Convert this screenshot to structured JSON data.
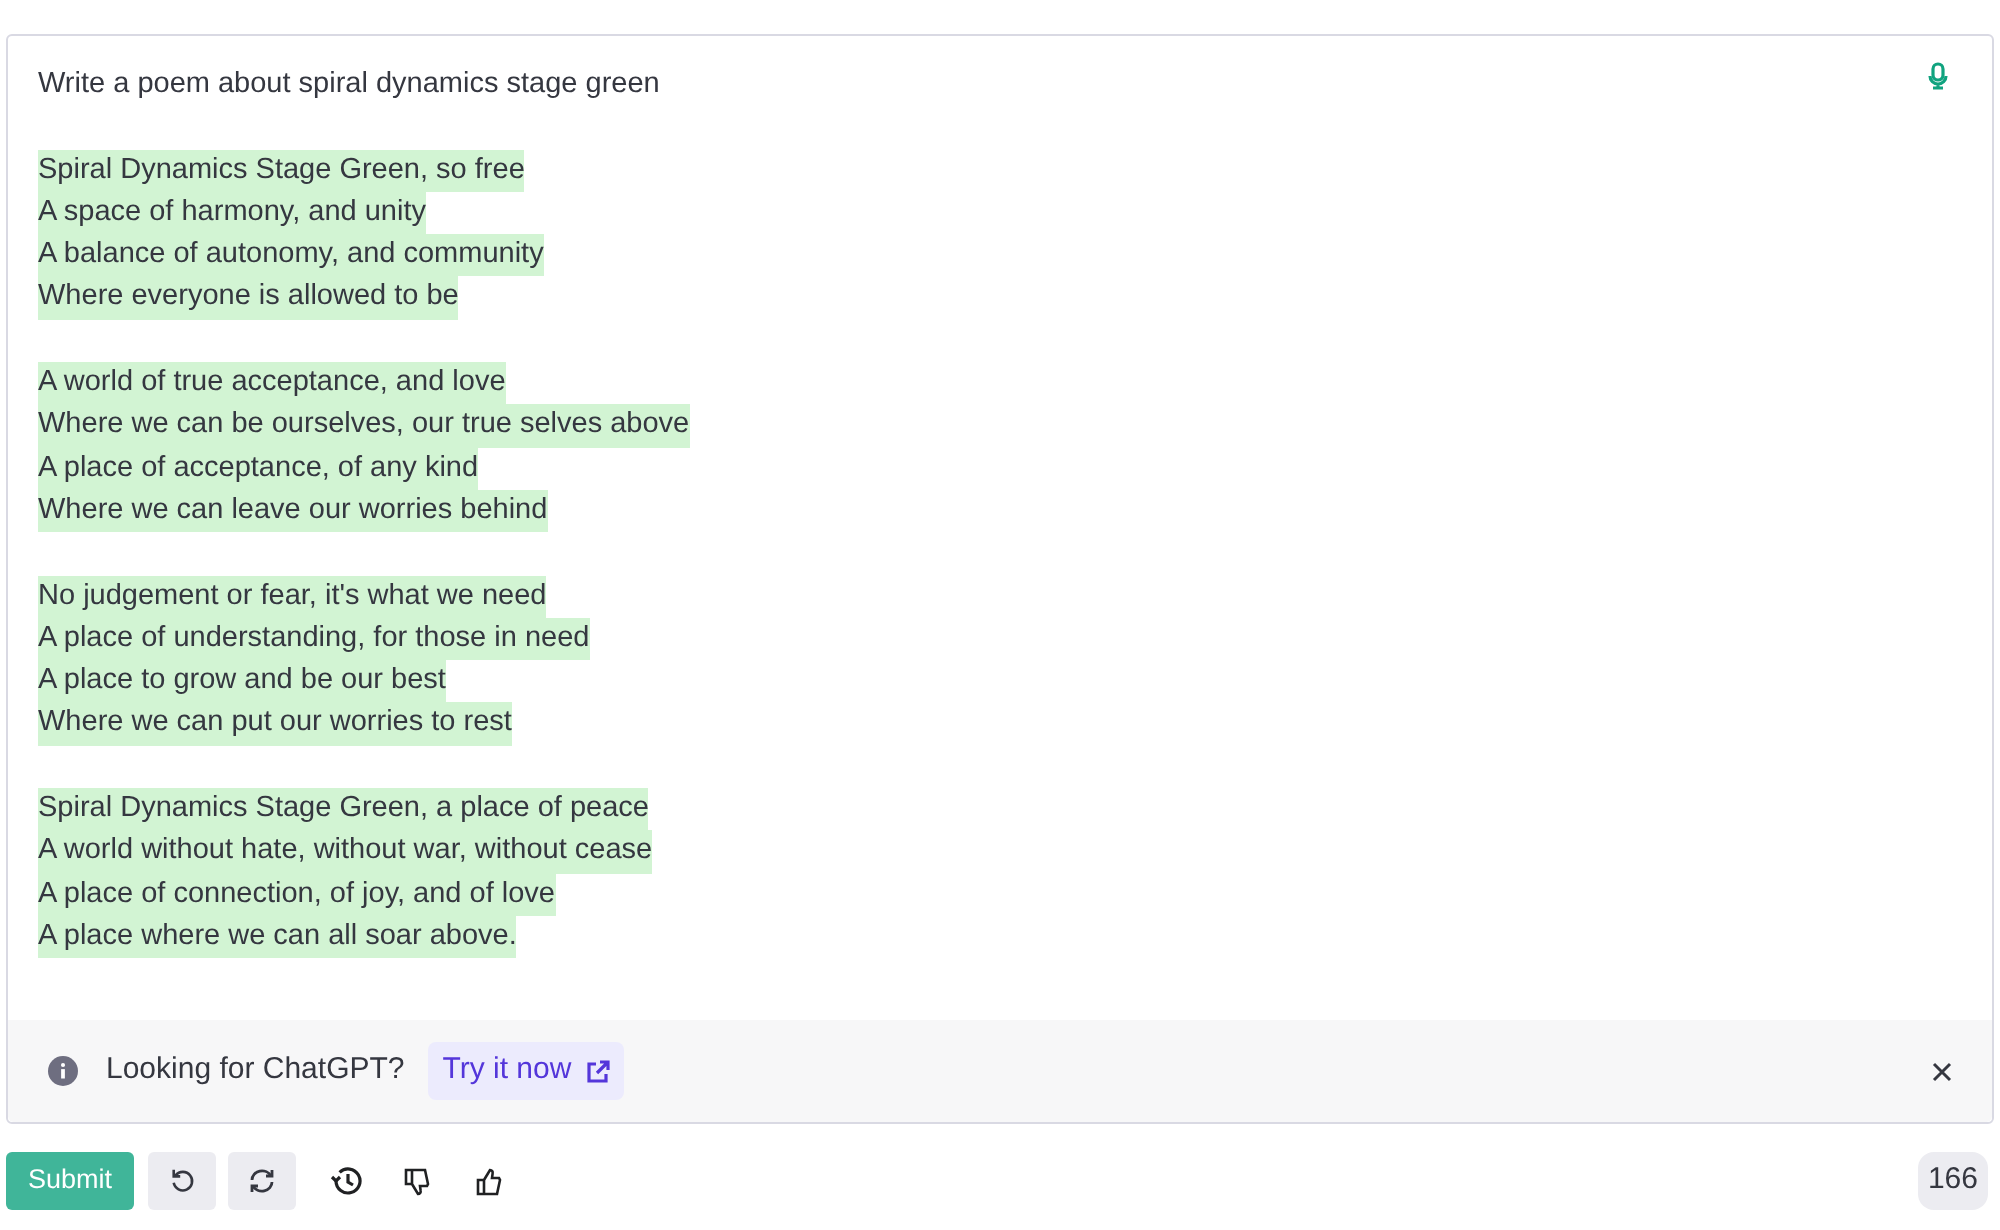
{
  "prompt": "Write a poem about spiral dynamics stage green",
  "stanzas": [
    [
      "Spiral Dynamics Stage Green, so free",
      "A space of harmony, and unity",
      "A balance of autonomy, and community",
      "Where everyone is allowed to be"
    ],
    [
      "A world of true acceptance, and love",
      "Where we can be ourselves, our true selves above",
      "A place of acceptance, of any kind",
      "Where we can leave our worries behind"
    ],
    [
      "No judgement or fear, it's what we need",
      "A place of understanding, for those in need",
      "A place to grow and be our best",
      "Where we can put our worries to rest"
    ],
    [
      "Spiral Dynamics Stage Green, a place of peace",
      "A world without hate, without war, without cease",
      "A place of connection, of joy, and of love",
      "A place where we can all soar above."
    ]
  ],
  "banner": {
    "text": "Looking for ChatGPT?",
    "link": "Try it now"
  },
  "submit": "Submit",
  "token_count": "166"
}
